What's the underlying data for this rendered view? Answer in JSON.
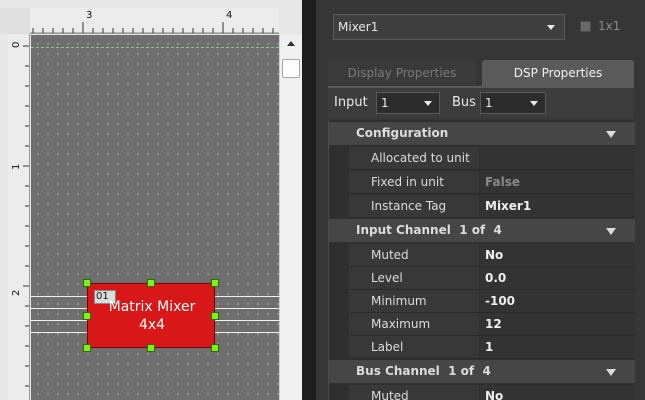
{
  "canvas": {
    "ruler_top_labels": [
      "3",
      "4"
    ],
    "ruler_left_labels": [
      "0",
      "1",
      "2"
    ],
    "block": {
      "instance_number": "01",
      "title_line1": "Matrix Mixer",
      "title_line2": "4x4",
      "color": "#d81818"
    }
  },
  "panel": {
    "component_select": {
      "value": "Mixer1"
    },
    "size_checkbox_label": "1x1",
    "tabs": [
      {
        "label": "Display Properties",
        "active": false
      },
      {
        "label": "DSP Properties",
        "active": true
      }
    ],
    "input_label": "Input",
    "input_value": "1",
    "bus_label": "Bus",
    "bus_value": "1",
    "sections": {
      "configuration": {
        "title": "Configuration",
        "props": [
          {
            "name": "Allocated to unit",
            "value": ""
          },
          {
            "name": "Fixed in unit",
            "value": "False"
          },
          {
            "name": "Instance Tag",
            "value": "Mixer1"
          }
        ]
      },
      "input_channel": {
        "title": "Input Channel  1 of  4",
        "props": [
          {
            "name": "Muted",
            "value": "No"
          },
          {
            "name": "Level",
            "value": "0.0"
          },
          {
            "name": "Minimum",
            "value": "-100"
          },
          {
            "name": "Maximum",
            "value": "12"
          },
          {
            "name": "Label",
            "value": "1"
          }
        ]
      },
      "bus_channel": {
        "title": "Bus Channel  1 of  4",
        "props": [
          {
            "name": "Muted",
            "value": "No"
          }
        ]
      }
    }
  }
}
